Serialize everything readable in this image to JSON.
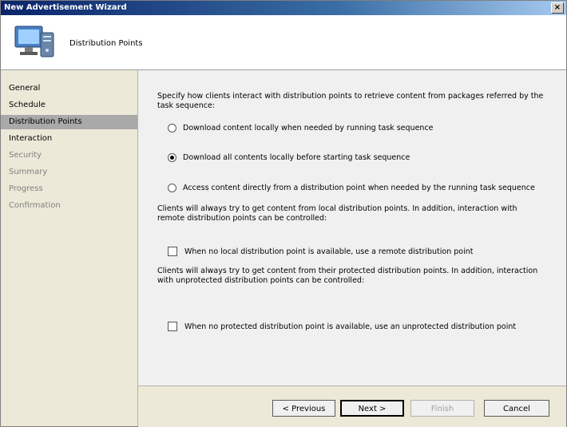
{
  "window": {
    "title": "New Advertisement Wizard",
    "close_glyph": "×"
  },
  "header": {
    "title": "Distribution Points",
    "icon": "computer-wizard-icon"
  },
  "sidebar": {
    "items": [
      {
        "label": "General",
        "state": "enabled"
      },
      {
        "label": "Schedule",
        "state": "enabled"
      },
      {
        "label": "Distribution Points",
        "state": "active"
      },
      {
        "label": "Interaction",
        "state": "enabled"
      },
      {
        "label": "Security",
        "state": "disabled"
      },
      {
        "label": "Summary",
        "state": "disabled"
      },
      {
        "label": "Progress",
        "state": "disabled"
      },
      {
        "label": "Confirmation",
        "state": "disabled"
      }
    ]
  },
  "main": {
    "intro": "Specify how clients interact with distribution points to retrieve content from packages referred by the task sequence:",
    "options": [
      {
        "label": "Download content locally when needed by running task sequence",
        "checked": false
      },
      {
        "label": "Download all contents locally before starting task sequence",
        "checked": true
      },
      {
        "label": "Access content directly from a distribution point when needed by the running task sequence",
        "checked": false
      }
    ],
    "remote_note": "Clients will always try to get content from local distribution points. In addition, interaction with remote distribution points can be controlled:",
    "remote_checkbox": {
      "label": "When no local distribution point is available, use a remote distribution point",
      "checked": false
    },
    "protected_note": "Clients will always try to get content from their protected distribution points. In addition, interaction with unprotected distribution points can be controlled:",
    "protected_checkbox": {
      "label": "When no protected distribution point is available, use an unprotected distribution point",
      "checked": false
    }
  },
  "buttons": {
    "previous": "< Previous",
    "next": "Next >",
    "finish": "Finish",
    "cancel": "Cancel"
  }
}
